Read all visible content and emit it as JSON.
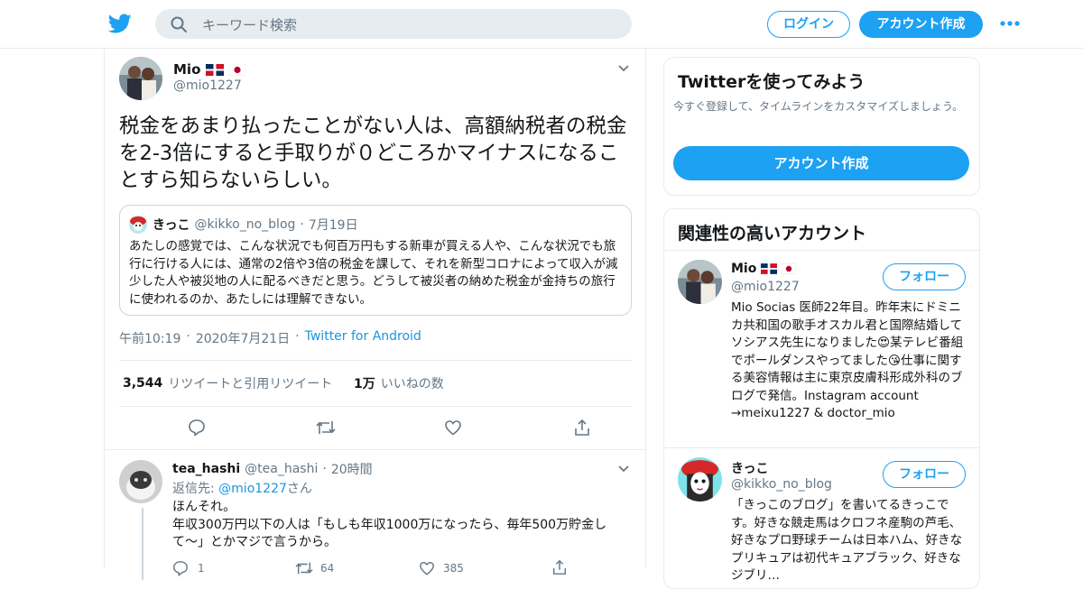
{
  "header": {
    "search_placeholder": "キーワード検索",
    "login_label": "ログイン",
    "signup_label": "アカウント作成"
  },
  "tweet": {
    "author_name": "Mio",
    "author_handle": "@mio1227",
    "text": "税金をあまり払ったことがない人は、高額納税者の税金を2-3倍にすると手取りが０どころかマイナスになることすら知らないらしい。",
    "quoted": {
      "name": "きっこ",
      "handle": "@kikko_no_blog",
      "date": "7月19日",
      "text": "あたしの感覚では、こんな状況でも何百万円もする新車が買える人や、こんな状況でも旅行に行ける人には、通常の2倍や3倍の税金を課して、それを新型コロナによって収入が減少した人や被災地の人に配るべきだと思う。どうして被災者の納めた税金が金持ちの旅行に使われるのか、あたしには理解できない。"
    },
    "time": "午前10:19",
    "date": "2020年7月21日",
    "source": "Twitter for Android",
    "retweet_count": "3,544",
    "retweet_label": "リツイートと引用リツイート",
    "like_count": "1万",
    "like_label": "いいねの数"
  },
  "reply": {
    "name": "tea_hashi",
    "handle": "@tea_hashi",
    "time": "20時間",
    "reply_to_prefix": "返信先: ",
    "reply_to_handle": "@mio1227",
    "reply_to_suffix": "さん",
    "line1": "ほんそれ。",
    "line2": "年収300万円以下の人は「もしも年収1000万になったら、毎年500万貯金して〜」とかマジで言うから。",
    "reply_count": "1",
    "retweet_count": "64",
    "like_count": "385"
  },
  "signup_card": {
    "title": "Twitterを使ってみよう",
    "subtitle": "今すぐ登録して、タイムラインをカスタマイズしましょう。",
    "button": "アカウント作成"
  },
  "related": {
    "title": "関連性の高いアカウント",
    "accounts": [
      {
        "name": "Mio",
        "handle": "@mio1227",
        "follow": "フォロー",
        "bio": "Mio Socias 医師22年目。昨年末にドミニカ共和国の歌手オスカル君と国際結婚してソシアス先生になりました😍某テレビ番組でポールダンスやってました😘仕事に関する美容情報は主に東京皮膚科形成外科のブログで発信。Instagram account →meixu1227 & doctor_mio"
      },
      {
        "name": "きっこ",
        "handle": "@kikko_no_blog",
        "follow": "フォロー",
        "bio": "「きっこのブログ」を書いてるきっこです。好きな競走馬はクロフネ産駒の芦毛、好きなプロ野球チームは日本ハム、好きなプリキュアは初代キュアブラック、好きなジブリ…"
      }
    ]
  },
  "colors": {
    "accent": "#1da1f2",
    "text": "#14171a",
    "muted": "#657786",
    "border": "#e6ecf0"
  }
}
